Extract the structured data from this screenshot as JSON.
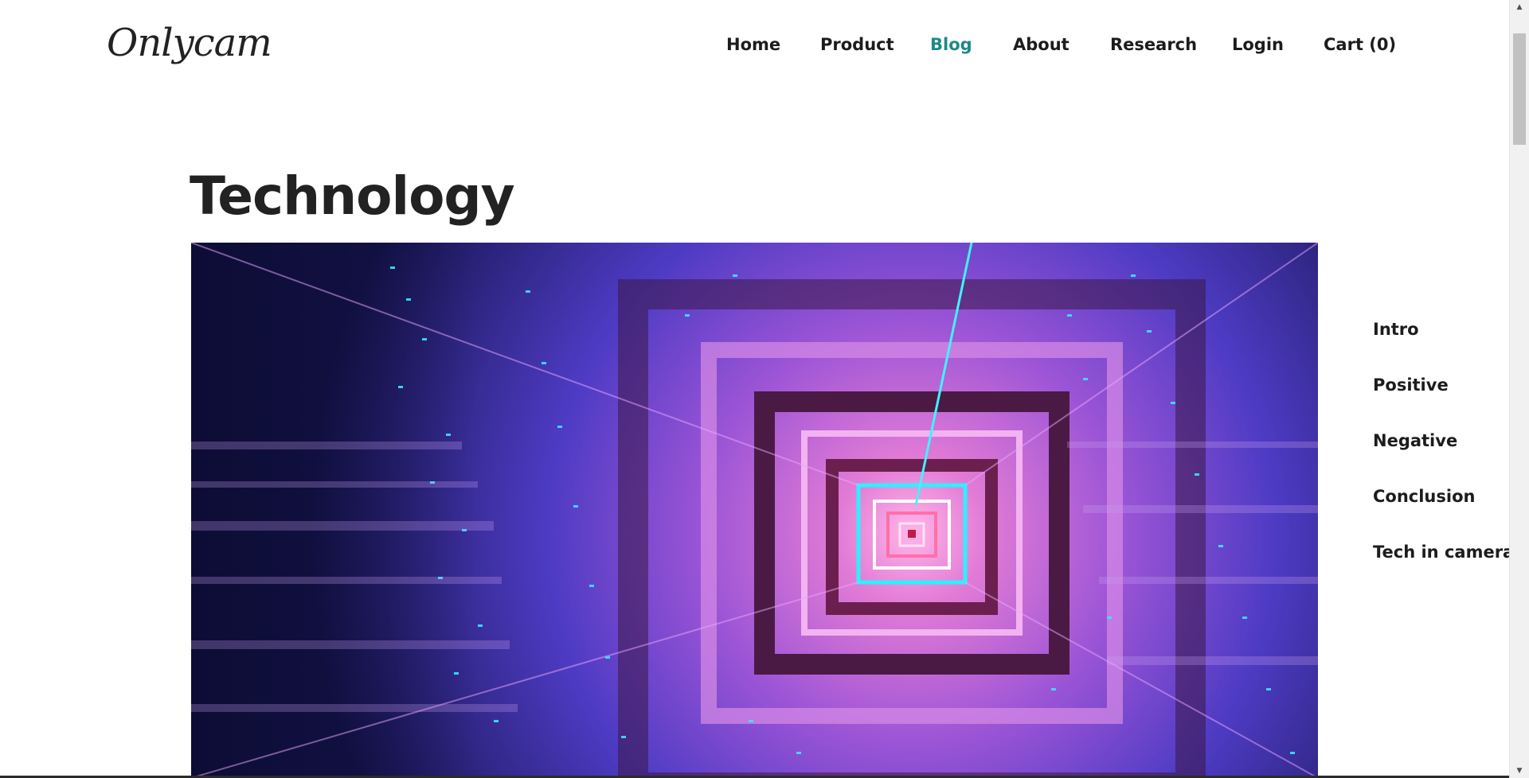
{
  "header": {
    "logo": "Onlycam",
    "nav": [
      {
        "label": "Home",
        "active": false
      },
      {
        "label": "Product",
        "active": false
      },
      {
        "label": "Blog",
        "active": true
      },
      {
        "label": "About",
        "active": false
      },
      {
        "label": "Research",
        "active": false
      },
      {
        "label": "Login",
        "active": false
      },
      {
        "label": "Cart (0)",
        "active": false
      }
    ]
  },
  "main": {
    "title": "Technology"
  },
  "toc": {
    "items": [
      "Intro",
      "Positive",
      "Negative",
      "Conclusion",
      "Tech in camera"
    ]
  },
  "colors": {
    "accent": "#1d8a86",
    "text": "#1c1c1c"
  }
}
